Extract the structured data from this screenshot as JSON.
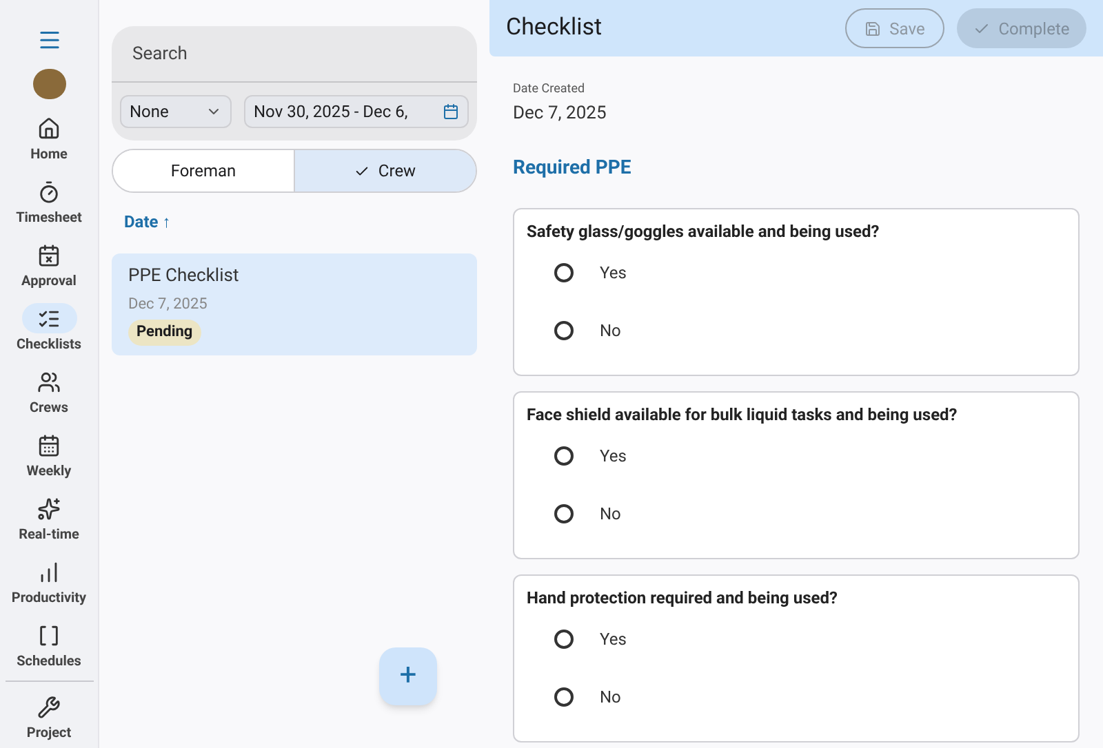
{
  "nav": [
    {
      "label": "Home",
      "selected": false
    },
    {
      "label": "Timesheet",
      "selected": false
    },
    {
      "label": "Approval",
      "selected": false
    },
    {
      "label": "Checklists",
      "selected": true
    },
    {
      "label": "Crews",
      "selected": false
    },
    {
      "label": "Weekly",
      "selected": false
    },
    {
      "label": "Real-time",
      "selected": false
    },
    {
      "label": "Productivity",
      "selected": false
    },
    {
      "label": "Schedules",
      "selected": false
    },
    {
      "label": "Project",
      "selected": false
    }
  ],
  "list_panel": {
    "search": {
      "placeholder": "Search"
    },
    "filter": {
      "value": "None"
    },
    "date_range": {
      "value": "Nov 30, 2025 - Dec 6,"
    },
    "toggle": [
      {
        "label": "Foreman",
        "selected": false
      },
      {
        "label": "Crew",
        "selected": true
      }
    ],
    "sort": {
      "label": "Date",
      "arrow": "↑"
    },
    "items": [
      {
        "title": "PPE Checklist",
        "date": "Dec 7, 2025",
        "status": "Pending",
        "selected": true
      }
    ],
    "fab": {
      "label": "+"
    }
  },
  "checklist": {
    "title": "Checklist",
    "save": {
      "label": "Save",
      "disabled": true
    },
    "complete": {
      "label": "Complete",
      "disabled": true
    },
    "date_label": "Date Created",
    "date": "Dec 7, 2025",
    "section": "Required PPE",
    "questions": [
      {
        "text": "Safety glass/goggles available and being used?",
        "options": [
          {
            "label": "Yes",
            "selected": false
          },
          {
            "label": "No",
            "selected": false
          }
        ]
      },
      {
        "text": "Face shield available for bulk liquid tasks and being used?",
        "options": [
          {
            "label": "Yes",
            "selected": false
          },
          {
            "label": "No",
            "selected": false
          }
        ]
      },
      {
        "text": "Hand protection required and being used?",
        "options": [
          {
            "label": "Yes",
            "selected": false
          },
          {
            "label": "No",
            "selected": false
          }
        ]
      }
    ]
  }
}
